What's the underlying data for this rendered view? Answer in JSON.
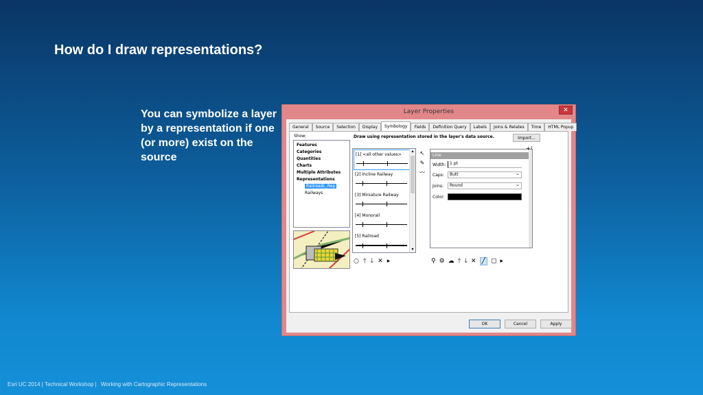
{
  "slide": {
    "title": "How do I draw representations?",
    "body": "You can symbolize a layer by a representation if one (or more) exist on the source",
    "footer": {
      "part1": "Esri UC 2014 | Technical Workshop |",
      "part2": "Working with Cartographic Representations"
    }
  },
  "dialog": {
    "title": "Layer Properties",
    "close_icon": "✕",
    "tabs": [
      "General",
      "Source",
      "Selection",
      "Display",
      "Symbology",
      "Fields",
      "Definition Query",
      "Labels",
      "Joins & Relates",
      "Time",
      "HTML Popup"
    ],
    "active_tab": "Symbology",
    "show_label": "Show:",
    "tree": {
      "items": [
        "Features",
        "Categories",
        "Quantities",
        "Charts",
        "Multiple Attributes",
        "Representations"
      ],
      "children": [
        "RailroadL_Rep",
        "Railways"
      ],
      "selected_child": "RailroadL_Rep"
    },
    "description": "Draw using representation stored in the layer's data source.",
    "import_button": "Import...",
    "rules": [
      "[1] <all other values>",
      "[2] Incline Railway",
      "[3] Miniature Railway",
      "[4] Monorail",
      "[5] Railroad"
    ],
    "properties": {
      "header": "Line",
      "add_icon": "+|",
      "width_label": "Width:",
      "width_value": "1 pt",
      "caps_label": "Caps:",
      "caps_value": "Butt",
      "joins_label": "Joins:",
      "joins_value": "Round",
      "color_label": "Color:",
      "color_value": "#000000"
    },
    "buttons": {
      "ok": "OK",
      "cancel": "Cancel",
      "apply": "Apply"
    }
  }
}
